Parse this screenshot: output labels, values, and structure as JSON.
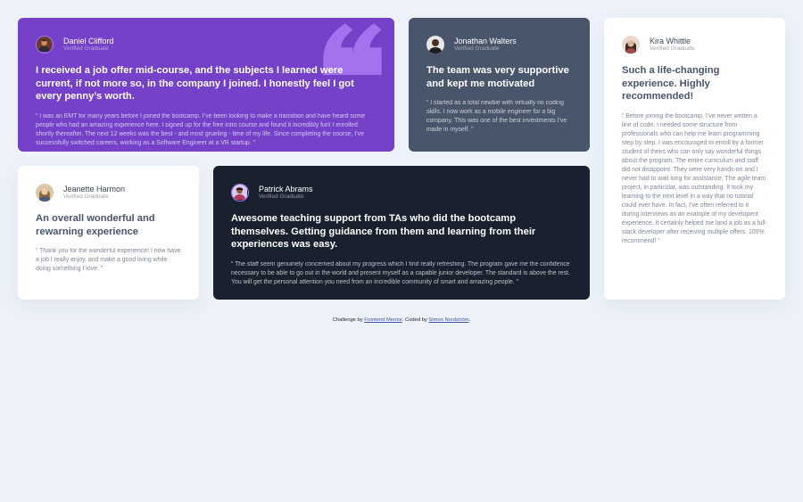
{
  "colors": {
    "purple": "#7541c8",
    "slate": "#48556a",
    "dark": "#19212e",
    "white": "#ffffff",
    "background": "#edf2fa",
    "quote_mark": "#a775f1",
    "footer_link": "#3e52a3"
  },
  "testimonials": [
    {
      "name": "Daniel Clifford",
      "role": "Verified Graduate",
      "headline": "I received a job offer mid-course, and the subjects I learned were current, if not more so, in the company I joined. I honestly feel I got every penny’s worth.",
      "body": "“ I was an EMT for many years before I joined the bootcamp. I’ve been looking to make a transition and have heard some people who had an amazing experience here. I signed up for the free intro course and found it incredibly fun! I enrolled shortly thereafter. The next 12 weeks was the best - and most grueling - time of my life. Since completing the course, I’ve successfully switched careers, working as a Software Engineer at a VR startup. ”",
      "avatar_icon": "avatar-daniel-icon"
    },
    {
      "name": "Jonathan Walters",
      "role": "Verified Graduate",
      "headline": "The team was very supportive and kept me motivated",
      "body": "“ I started as a total newbie with virtually no coding skills. I now work as a mobile engineer for a big company. This was one of the best investments I’ve made in myself. ”",
      "avatar_icon": "avatar-jonathan-icon"
    },
    {
      "name": "Kira Whittle",
      "role": "Verified Graduate",
      "headline": "Such a life-changing experience. Highly recommended!",
      "body": "“ Before joining the bootcamp, I’ve never written a line of code. I needed some structure from professionals who can help me learn programming step by step. I was encouraged to enroll by a former student of theirs who can only say wonderful things about the program. The entire curriculum and staff did not disappoint. They were very hands-on and I never had to wait long for assistance. The agile team project, in particular, was outstanding. It took my learning to the next level in a way that no tutorial could ever have. In fact, I’ve often referred to it during interviews as an example of my developent experience. It certainly helped me land a job as a full-stack developer after receiving multiple offers. 100% recommend! ”",
      "avatar_icon": "avatar-kira-icon"
    },
    {
      "name": "Jeanette Harmon",
      "role": "Verified Graduate",
      "headline": "An overall wonderful and rewarning experience",
      "body": "“ Thank you for the wonderful experience! I now have a job I really enjoy, and make a good living while doing something I love. ”",
      "avatar_icon": "avatar-jeanette-icon"
    },
    {
      "name": "Patrick Abrams",
      "role": "Verified Graduate",
      "headline": "Awesome teaching support from TAs who did the bootcamp themselves. Getting guidance from them and learning from their experiences was easy.",
      "body": "“ The staff seem genuinely concerned about my progress which I find really refreshing. The program gave me the confidence necessary to be able to go out in the world and present myself as a capable junior developer. The standard is above the rest. You will get the personal attention you need from an incredible community of smart and amazing people. ”",
      "avatar_icon": "avatar-patrick-icon"
    }
  ],
  "footer": {
    "prefix": "Challenge by ",
    "link1": "Frontend Mentor",
    "middle": ". Coded by ",
    "link2": "Simon Nordström",
    "suffix": "."
  }
}
